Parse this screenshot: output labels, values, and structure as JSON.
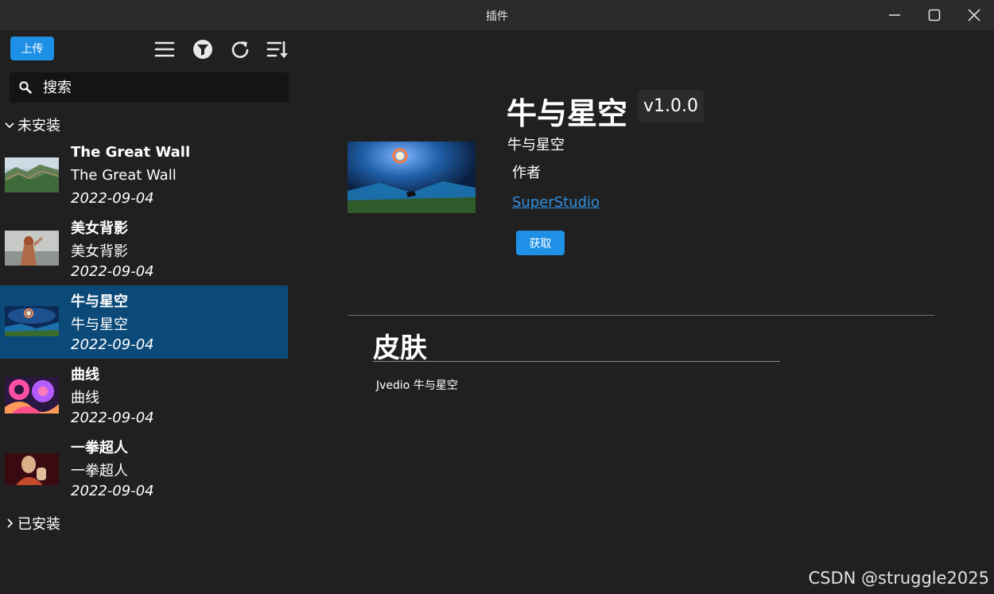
{
  "window": {
    "title": "插件"
  },
  "toolbar": {
    "upload_label": "上传"
  },
  "search": {
    "placeholder": "搜索"
  },
  "groups": {
    "not_installed": "未安装",
    "installed": "已安装"
  },
  "plugins": [
    {
      "name": "The Great Wall",
      "desc": "The Great Wall",
      "date": "2022-09-04"
    },
    {
      "name": "美女背影",
      "desc": "美女背影",
      "date": "2022-09-04"
    },
    {
      "name": "牛与星空",
      "desc": "牛与星空",
      "date": "2022-09-04",
      "selected": true
    },
    {
      "name": "曲线",
      "desc": "曲线",
      "date": "2022-09-04"
    },
    {
      "name": "一拳超人",
      "desc": "一拳超人",
      "date": "2022-09-04"
    }
  ],
  "detail": {
    "title": "牛与星空",
    "version": "v1.0.0",
    "subtitle": "牛与星空",
    "author_label": "作者",
    "author_name": "SuperStudio",
    "get_label": "获取",
    "section_heading": "皮肤",
    "section_text": "Jvedio 牛与星空"
  },
  "watermark": "CSDN @struggle2025",
  "colors": {
    "accent": "#1e90e6",
    "selected_bg": "#0b4a78",
    "background": "#202020",
    "link": "#2f8fe0"
  }
}
